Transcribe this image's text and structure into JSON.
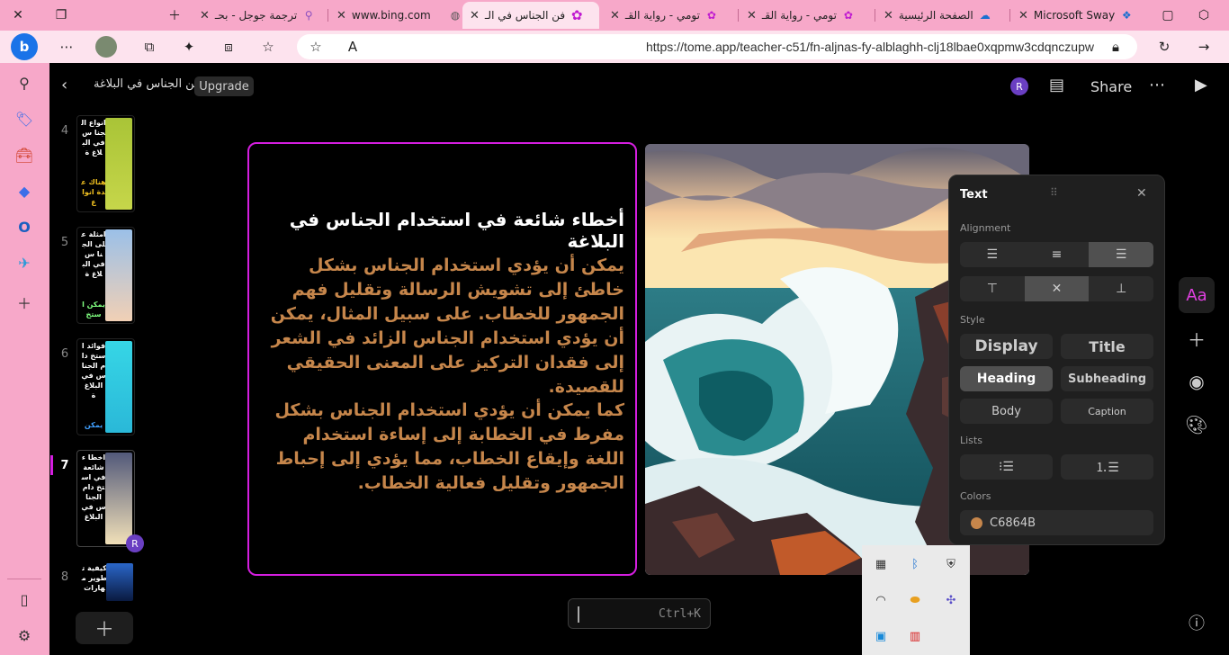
{
  "browser": {
    "tabs": [
      {
        "title": "ترجمة جوجل - بحـ",
        "icon": "search-icon"
      },
      {
        "title": "www.bing.com",
        "icon": "globe-icon"
      },
      {
        "title": "فن الجناس في الـ",
        "icon": "tome-icon",
        "active": true
      },
      {
        "title": "تومي - رواية القـ",
        "icon": "tome-icon"
      },
      {
        "title": "تومي - رواية القـ",
        "icon": "tome-icon"
      },
      {
        "title": "الصفحة الرئيسية",
        "icon": "onedrive-icon"
      },
      {
        "title": "Microsoft Sway",
        "icon": "sway-icon"
      }
    ],
    "url": "https://tome.app/teacher-c51/fn-aljnas-fy-alblaghh-clj18lbae0xqpmw3cdqnczupw"
  },
  "app": {
    "doc_title": "فن الجناس في البلاغة",
    "upgrade_label": "Upgrade",
    "share_label": "Share",
    "avatar_letter": "R",
    "command_hint": "Ctrl+K"
  },
  "thumbnails": [
    {
      "num": "4",
      "text": "انواع الجنا س في البلاغ ة",
      "sub": "هناك عدة انواع",
      "sub_color": "#f0c020",
      "gradient": [
        "#a9c437",
        "#c6d64a"
      ]
    },
    {
      "num": "5",
      "text": "امثلة على الجنا س في البلاغ ة",
      "sub": "يمكن استخ",
      "sub_color": "#80ff80",
      "gradient": [
        "#9bc0e8",
        "#f1d0b5"
      ]
    },
    {
      "num": "6",
      "text": "فوائد استخ دام الجنا س في البلاغ ة",
      "sub": "يمكن",
      "sub_color": "#40a0ff",
      "gradient": [
        "#36d6e6",
        "#2ab8d8"
      ]
    },
    {
      "num": "7",
      "text": "اخطا ء شائعة في استخ دام الجنا س في البلاغ",
      "sub": "",
      "sub_color": "#fff",
      "gradient": [
        "#52597a",
        "#f1e0b8"
      ],
      "active": true
    },
    {
      "num": "8",
      "text": "كيفية تطوير مهارات",
      "sub": "",
      "sub_color": "#fff",
      "gradient": [
        "#2a66c8",
        "#0a1a40"
      ]
    }
  ],
  "slide": {
    "title": "أخطاء شائعة في استخدام الجناس في البلاغة",
    "paragraph1": "يمكن أن يؤدي استخدام الجناس بشكل خاطئ إلى تشويش الرسالة وتقليل فهم الجمهور للخطاب. على سبيل المثال، يمكن أن يؤدي استخدام الجناس الزائد في الشعر إلى فقدان التركيز على المعنى الحقيقي للقصيدة.",
    "paragraph2": "كما يمكن أن يؤدي استخدام الجناس بشكل مفرط في الخطابة إلى إساءة استخدام اللغة وإيقاع الخطاب، مما يؤدي إلى إحباط الجمهور وتقليل فعالية الخطاب.",
    "text_color": "#c6864b",
    "border_color": "#d51ee0"
  },
  "text_panel": {
    "title": "Text",
    "alignment_label": "Alignment",
    "style_label": "Style",
    "lists_label": "Lists",
    "colors_label": "Colors",
    "styles": [
      "Display",
      "Title",
      "Heading",
      "Subheading",
      "Body",
      "Caption"
    ],
    "selected_style": "Heading",
    "selected_h_align": "right",
    "selected_v_align": "middle",
    "color_value": "C6864B",
    "color_swatch": "#c6864b"
  },
  "rail": {
    "aa_label": "Aa"
  }
}
